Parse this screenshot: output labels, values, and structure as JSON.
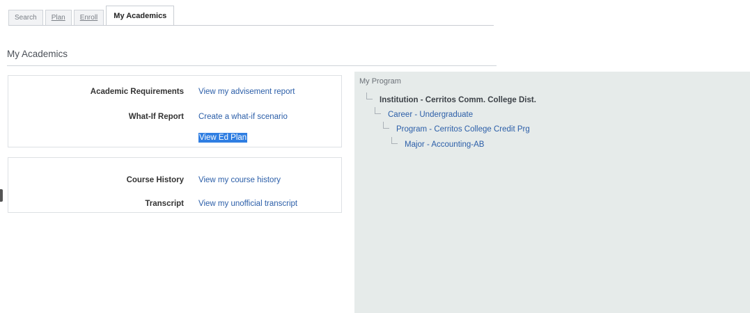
{
  "tabs": [
    {
      "label": "Search"
    },
    {
      "label": "Plan"
    },
    {
      "label": "Enroll"
    },
    {
      "label": "My Academics"
    }
  ],
  "page_title": "My Academics",
  "academics_box": {
    "rows": [
      {
        "label": "Academic Requirements",
        "link": "View my advisement report"
      },
      {
        "label": "What-If Report",
        "link": "Create a what-if scenario"
      },
      {
        "label": "",
        "link": "View Ed Plan"
      }
    ]
  },
  "history_box": {
    "rows": [
      {
        "label": "Course History",
        "link": "View my course history"
      },
      {
        "label": "Transcript",
        "link": "View my unofficial transcript"
      }
    ]
  },
  "program": {
    "heading": "My Program",
    "nodes": [
      {
        "text": "Institution - Cerritos Comm. College Dist."
      },
      {
        "text": "Career - Undergraduate"
      },
      {
        "text": "Program - Cerritos College Credit Prg"
      },
      {
        "text": "Major - Accounting-AB"
      }
    ]
  },
  "colors": {
    "link": "#2b5ea8",
    "selection": "#2f7ee2",
    "program_panel_bg": "#e6ebea"
  }
}
